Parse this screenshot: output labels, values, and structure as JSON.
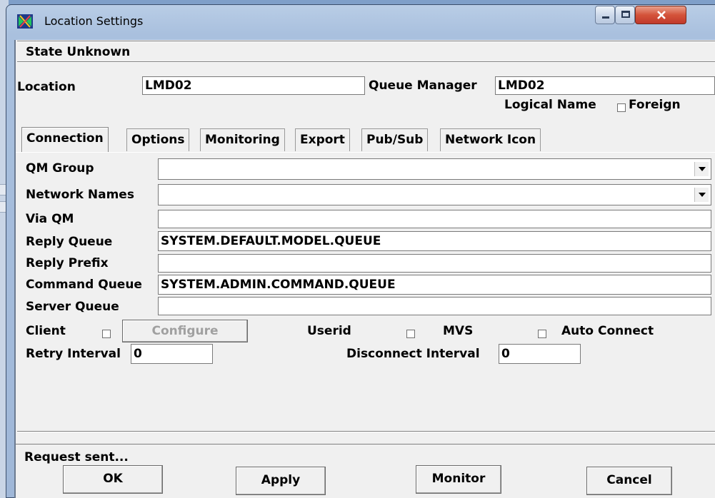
{
  "window": {
    "title": "Location Settings"
  },
  "state": "State Unknown",
  "location": {
    "label": "Location",
    "value": "LMD02"
  },
  "queue_manager": {
    "label": "Queue Manager",
    "value": "LMD02"
  },
  "logical_name": {
    "label": "Logical Name",
    "checked": false
  },
  "foreign": {
    "label": "Foreign",
    "checked": true
  },
  "tabs": [
    {
      "label": "Connection",
      "active": true
    },
    {
      "label": "Options"
    },
    {
      "label": "Monitoring"
    },
    {
      "label": "Export"
    },
    {
      "label": "Pub/Sub"
    },
    {
      "label": "Network Icon"
    }
  ],
  "connection": {
    "qm_group": {
      "label": "QM Group",
      "value": ""
    },
    "network_names": {
      "label": "Network Names",
      "value": ""
    },
    "via_qm": {
      "label": "Via QM",
      "value": ""
    },
    "reply_queue": {
      "label": "Reply Queue",
      "value": "SYSTEM.DEFAULT.MODEL.QUEUE"
    },
    "reply_prefix": {
      "label": "Reply Prefix",
      "value": ""
    },
    "command_queue": {
      "label": "Command Queue",
      "value": "SYSTEM.ADMIN.COMMAND.QUEUE"
    },
    "server_queue": {
      "label": "Server Queue",
      "value": ""
    },
    "client": {
      "label": "Client",
      "checked": false
    },
    "configure_label": "Configure",
    "userid": {
      "label": "Userid",
      "checked": false
    },
    "mvs": {
      "label": "MVS",
      "checked": false
    },
    "auto_connect": {
      "label": "Auto Connect",
      "checked": false
    },
    "retry_interval": {
      "label": "Retry Interval",
      "value": "0"
    },
    "disconnect_interval": {
      "label": "Disconnect Interval",
      "value": "0"
    }
  },
  "status": "Request sent...",
  "buttons": {
    "ok": "OK",
    "apply": "Apply",
    "monitor": "Monitor",
    "cancel": "Cancel"
  },
  "colors": {
    "title_gradient": "#a9c0de",
    "close_button": "#c0392b",
    "dialog_bg": "#f0f0f0"
  }
}
